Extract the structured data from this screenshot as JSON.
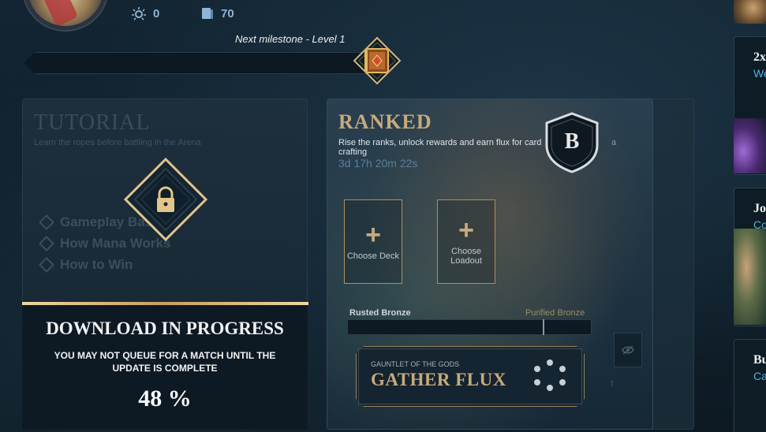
{
  "header": {
    "stats": [
      {
        "icon": "rank-points-icon",
        "value": "0"
      },
      {
        "icon": "card-collection-icon",
        "value": "70"
      }
    ],
    "milestone": {
      "label": "Next milestone - Level 1",
      "progress": 0.0
    }
  },
  "tutorial": {
    "title": "TUTORIAL",
    "subtitle": "Learn the ropes before battling in the Arena",
    "items": [
      "Gameplay Basics",
      "How Mana Works",
      "How to Win"
    ],
    "download": {
      "title": "DOWNLOAD IN PROGRESS",
      "message": "YOU MAY NOT QUEUE FOR A MATCH UNTIL THE UPDATE IS COMPLETE",
      "percent": "48 %"
    }
  },
  "ranked": {
    "title": "RANKED",
    "description": "Rise the ranks, unlock rewards and earn flux for card crafting",
    "description_tail": "a",
    "timer": "3d 17h 20m 22s",
    "badge_letter": "B",
    "choose_deck": "Choose Deck",
    "choose_loadout": "Choose Loadout",
    "rank_from": "Rusted Bronze",
    "rank_to": "Purified Bronze",
    "rank_progress": 0.8,
    "flux_small": "GAUNTLET OF THE GODS",
    "flux_big": "GATHER FLUX",
    "faint_letter": "r"
  },
  "side_cards": [
    {
      "title": "2x",
      "sub": "We"
    },
    {
      "title": "Jo",
      "sub": "Co"
    },
    {
      "title": "Bu",
      "sub": "Ca"
    }
  ],
  "colors": {
    "gold": "#c8aa7a",
    "gold_light": "#f0d6a0",
    "accent_blue": "#4fb2d8",
    "stat_blue": "#8fb5d6",
    "background": "#132533"
  }
}
